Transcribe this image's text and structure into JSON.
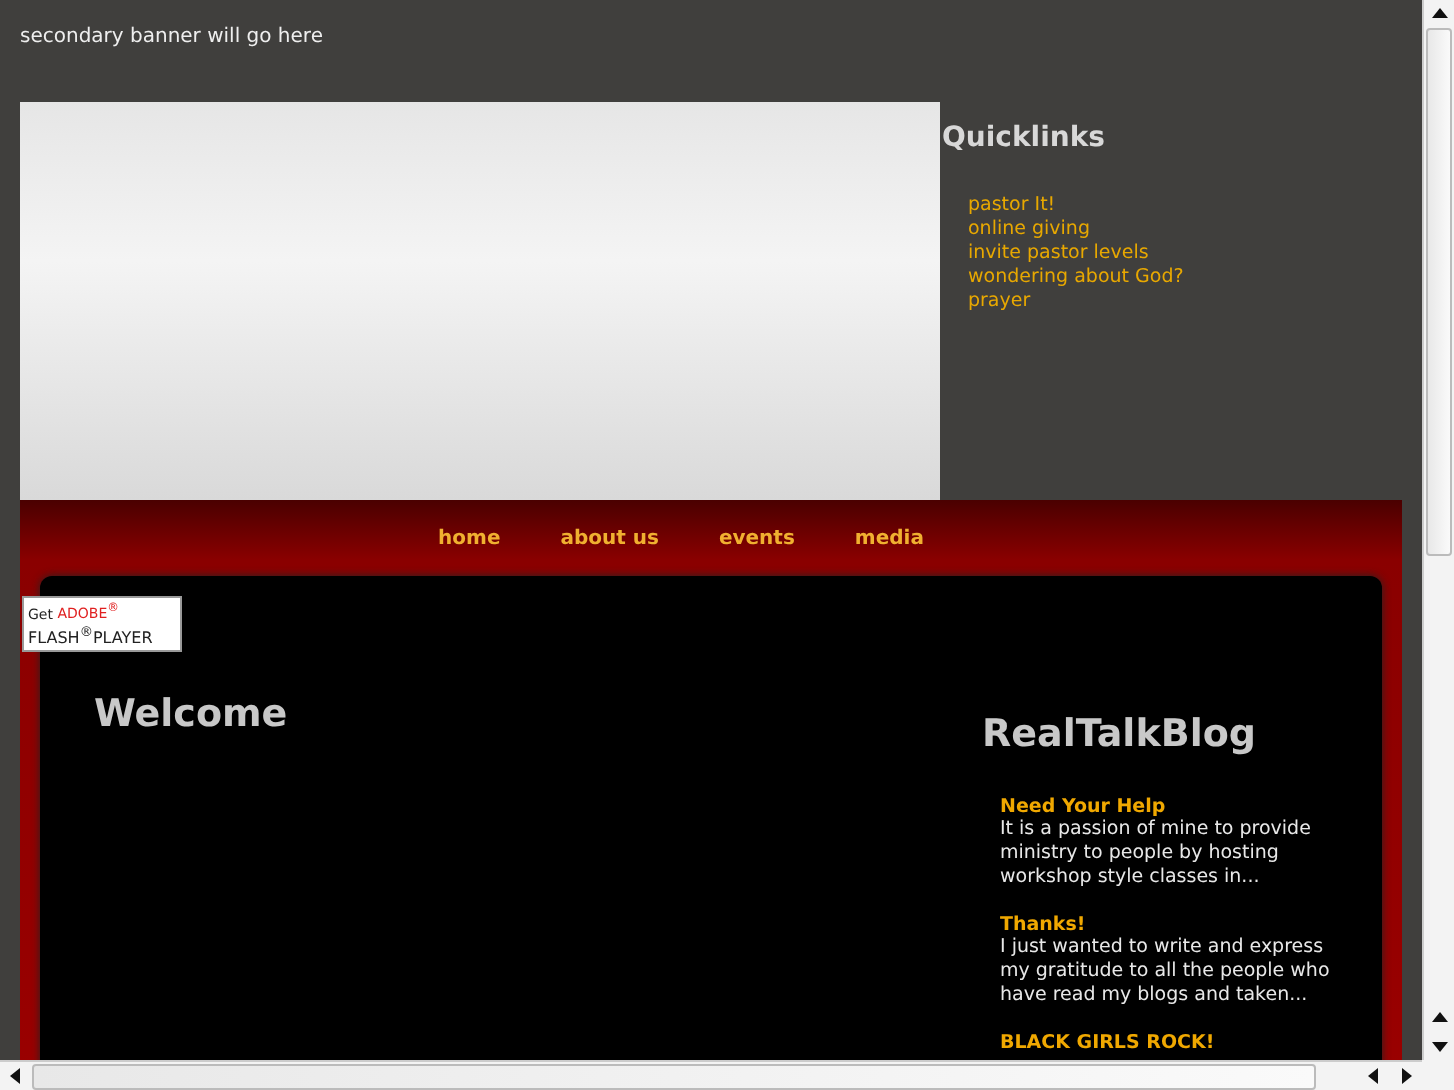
{
  "banner": {
    "text": "secondary banner will go here"
  },
  "quicklinks": {
    "title": "Quicklinks",
    "links": [
      "pastor It!",
      "online giving",
      "invite pastor levels",
      "wondering about God?",
      "prayer"
    ]
  },
  "nav": [
    "home",
    "about us",
    "events",
    "media"
  ],
  "flash_badge": {
    "get": "Get",
    "brand": "ADOBE$^{®}$",
    "product": "FLASH$^{®}$PLAYER"
  },
  "welcome": {
    "title": "Welcome"
  },
  "blog": {
    "title": "RealTalkBlog",
    "posts": [
      {
        "title": "Need Your Help",
        "excerpt": "It is a passion of mine to provide ministry to people by hosting workshop style classes in..."
      },
      {
        "title": "Thanks!",
        "excerpt": "I just wanted to write and express my gratitude to all the people who have read my blogs and taken..."
      },
      {
        "title": "BLACK GIRLS ROCK!"
      }
    ]
  }
}
